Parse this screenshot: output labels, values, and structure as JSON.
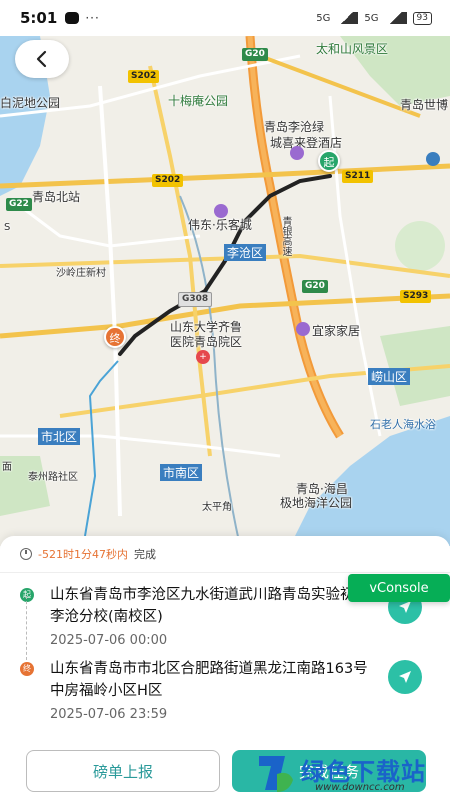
{
  "status_bar": {
    "time": "5:01",
    "dots": "···",
    "signal1": "5G",
    "signal2": "5G",
    "battery": "93"
  },
  "map": {
    "labels": {
      "taihe": "太和山风景区",
      "bainidi": "白泥地公园",
      "shimeian": "十梅庵公园",
      "licang_inn": "青岛李沧绿",
      "licang_inn2": "城喜来登酒店",
      "qingdao_shi": "青岛世博",
      "qingdao_north": "青岛北站",
      "weidong": "伟东·乐客城",
      "licang_district": "李沧区",
      "shaling": "沙岭庄新村",
      "hospital1": "山东大学齐鲁",
      "hospital2": "医院青岛院区",
      "yiju": "宜家家居",
      "laoshan": "崂山区",
      "shibei": "市北区",
      "taizhou": "泰州路社区",
      "shinan": "市南区",
      "polar1": "青岛·海昌",
      "polar2": "极地海洋公园",
      "shilaoren": "石老人海水浴",
      "taiping": "太平角",
      "yinhighway": "青银高速",
      "s_jiao": "S",
      "mianban": "面"
    },
    "shields": {
      "g20_top": "G20",
      "s202_a": "S202",
      "s202_b": "S202",
      "s211": "S211",
      "g22": "G22",
      "g20_mid": "G20",
      "g308": "G308",
      "s293": "S293"
    },
    "start_marker": "起",
    "end_marker": "终"
  },
  "trip": {
    "duration": "-521时1分47秒内",
    "status": "完成"
  },
  "stops": [
    {
      "badge": "起",
      "address": "山东省青岛市李沧区九水街道武川路青岛实验初中李沧分校(南校区)",
      "time": "2025-07-06 00:00"
    },
    {
      "badge": "终",
      "address": "山东省青岛市市北区合肥路街道黑龙江南路163号中房福岭小区H区",
      "time": "2025-07-06 23:59"
    }
  ],
  "vconsole_label": "vConsole",
  "buttons": {
    "report": "磅单上报",
    "complete": "完成任务"
  },
  "watermark": {
    "text": "绿色下载站",
    "url": "www.downcc.com"
  },
  "colors": {
    "accent": "#29b7a5",
    "start": "#27a56a",
    "end": "#e67334",
    "route": "#222222"
  }
}
